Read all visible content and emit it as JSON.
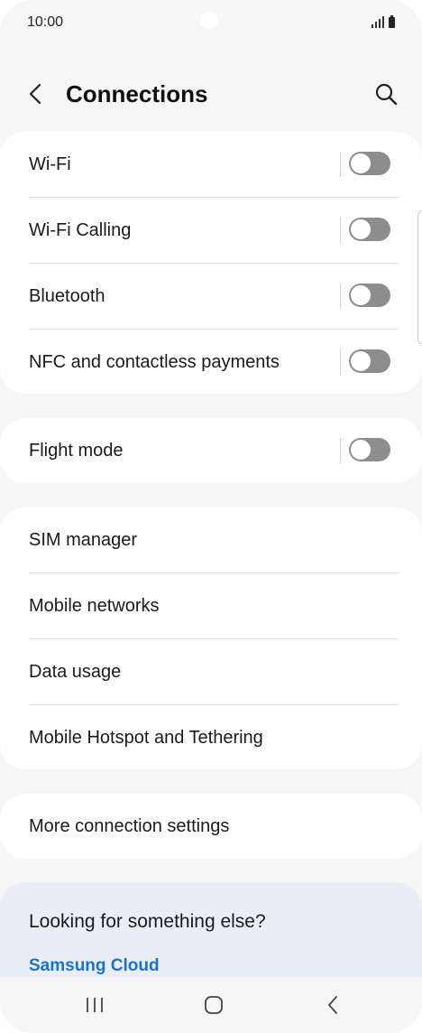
{
  "status_bar": {
    "time": "10:00"
  },
  "header": {
    "title": "Connections"
  },
  "group1": [
    {
      "label": "Wi-Fi",
      "toggle_on": false
    },
    {
      "label": "Wi-Fi Calling",
      "toggle_on": false
    },
    {
      "label": "Bluetooth",
      "toggle_on": false
    },
    {
      "label": "NFC and contactless payments",
      "toggle_on": false
    }
  ],
  "group2": [
    {
      "label": "Flight mode",
      "toggle_on": false
    }
  ],
  "group3": [
    {
      "label": "SIM manager"
    },
    {
      "label": "Mobile networks"
    },
    {
      "label": "Data usage"
    },
    {
      "label": "Mobile Hotspot and Tethering"
    }
  ],
  "group4": [
    {
      "label": "More connection settings"
    }
  ],
  "suggestion": {
    "title": "Looking for something else?",
    "link": "Samsung Cloud"
  },
  "colors": {
    "accent_link": "#1a73c5",
    "toggle_off": "#8d8d8d",
    "background": "#f6f6f6"
  },
  "icons": {
    "back": "chevron-left-icon",
    "search": "search-icon",
    "recents": "recents-icon",
    "home": "home-icon",
    "nav_back": "nav-back-icon"
  }
}
